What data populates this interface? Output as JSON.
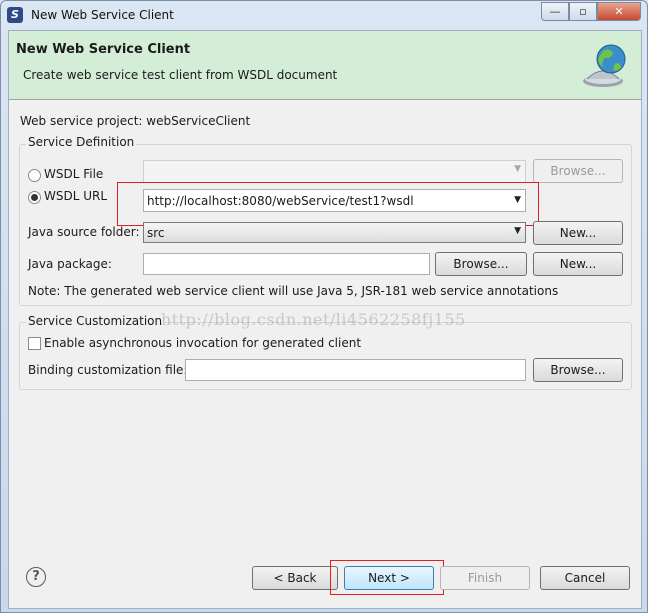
{
  "window": {
    "title": "New Web Service Client",
    "app_icon_glyph": "S",
    "controls": {
      "minimize": "—",
      "maximize": "▫",
      "close": "✕"
    }
  },
  "header": {
    "title": "New Web Service Client",
    "subtitle": "Create web service test client from WSDL document",
    "icon": "globe-icon"
  },
  "project": {
    "label": "Web service project:",
    "value": "webServiceClient"
  },
  "service_definition": {
    "group_title": "Service Definition",
    "wsdl_file": {
      "label": "WSDL File",
      "selected": false,
      "value": "",
      "browse_label": "Browse..."
    },
    "wsdl_url": {
      "label": "WSDL URL",
      "selected": true,
      "value": "http://localhost:8080/webService/test1?wsdl"
    },
    "source_folder": {
      "label": "Java source folder:",
      "value": "src",
      "new_label": "New..."
    },
    "package": {
      "label": "Java package:",
      "value": "",
      "browse_label": "Browse...",
      "new_label": "New..."
    },
    "note": "Note: The generated web service client will use Java 5, JSR-181 web service annotations"
  },
  "service_customization": {
    "group_title": "Service Customization",
    "async": {
      "label": "Enable asynchronous invocation for generated client",
      "checked": false
    },
    "binding": {
      "label": "Binding customization file:",
      "value": "",
      "browse_label": "Browse..."
    }
  },
  "watermark": "http://blog.csdn.net/li4562258fj155",
  "footer": {
    "help_glyph": "?",
    "back_label": "< Back",
    "next_label": "Next >",
    "finish_label": "Finish",
    "cancel_label": "Cancel"
  },
  "colors": {
    "header_bg": "#d3edd6",
    "annotation_red": "#e02020"
  }
}
